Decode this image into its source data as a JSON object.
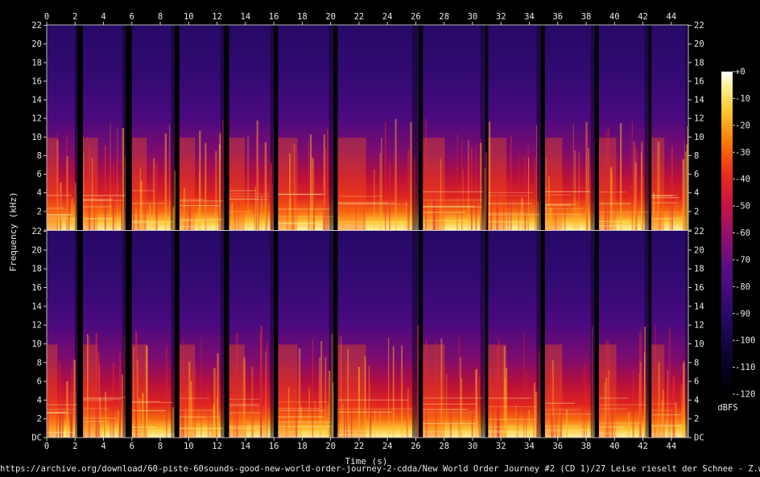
{
  "chart_data": {
    "type": "heatmap",
    "title": "",
    "xlabel": "Time (s)",
    "ylabel": "Frequency (kHz)",
    "x_ticks": [
      "0",
      "2",
      "4",
      "6",
      "8",
      "10",
      "12",
      "14",
      "16",
      "18",
      "20",
      "22",
      "24",
      "26",
      "28",
      "30",
      "32",
      "34",
      "36",
      "38",
      "40",
      "42",
      "44"
    ],
    "xlim": [
      0,
      45.2
    ],
    "y_ticks": [
      "DC",
      "2",
      "4",
      "6",
      "8",
      "10",
      "12",
      "14",
      "16",
      "18",
      "20",
      "22"
    ],
    "ylim_khz": [
      0,
      22.05
    ],
    "channels": 2,
    "colorbar": {
      "label": "dBFS",
      "ticks": [
        "+0",
        "-10",
        "-20",
        "-30",
        "-40",
        "-50",
        "-60",
        "-70",
        "-80",
        "-90",
        "-100",
        "-110",
        "-120"
      ],
      "range_db": [
        -120,
        0
      ]
    },
    "segments_s": [
      [
        0,
        2.15
      ],
      [
        2.55,
        5.55
      ],
      [
        6.0,
        9.0
      ],
      [
        9.35,
        12.5
      ],
      [
        12.85,
        16.0
      ],
      [
        16.3,
        20.2
      ],
      [
        20.5,
        26.2
      ],
      [
        26.5,
        30.9
      ],
      [
        31.1,
        34.8
      ],
      [
        35.1,
        38.6
      ],
      [
        38.9,
        42.4
      ],
      [
        42.6,
        45.2
      ]
    ],
    "colors": {
      "background": "#000000",
      "low": "#0a0020",
      "mid": "#c0102a",
      "high": "#ffffd0"
    }
  },
  "source_url": "https://archive.org/download/60-piste-60sounds-good-new-world-order-journey-2-cdda/New World Order Journey #2 (CD 1)/27 Leise rieselt der Schnee - Z.wav"
}
